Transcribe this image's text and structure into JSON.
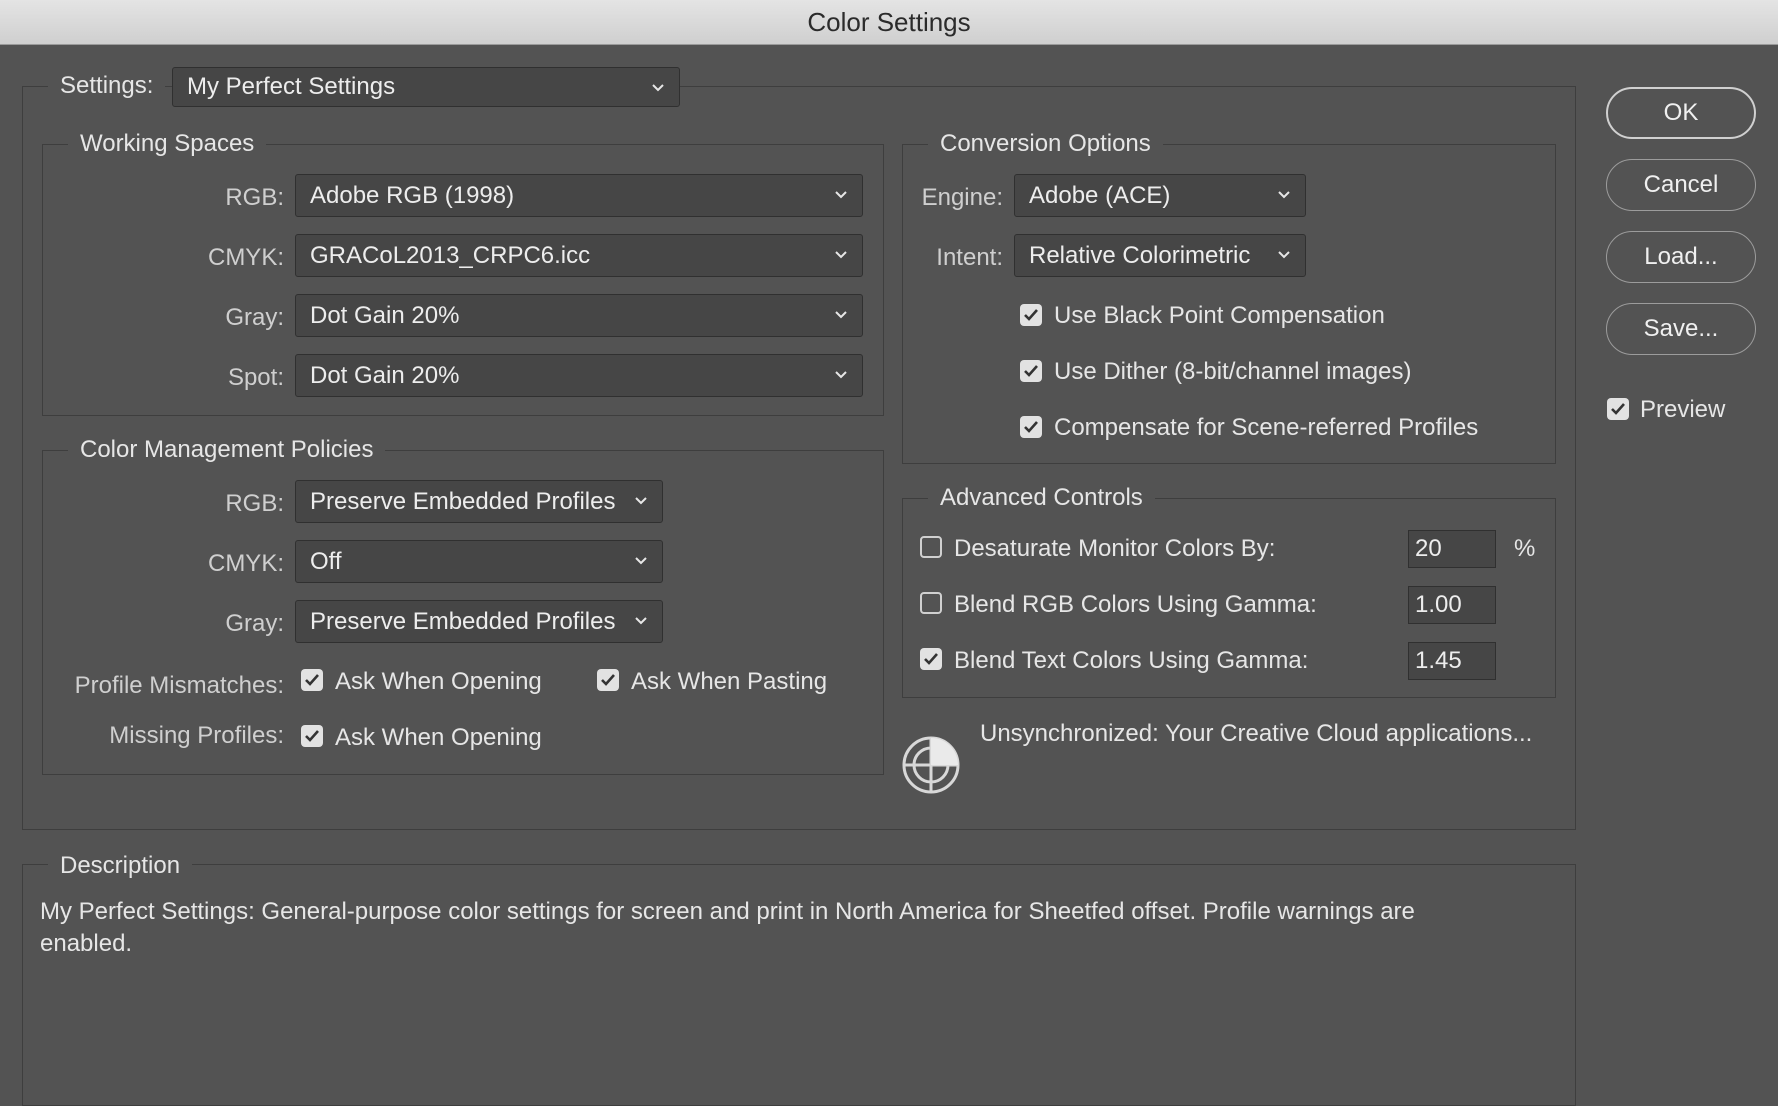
{
  "window": {
    "title": "Color Settings"
  },
  "settings": {
    "label": "Settings:",
    "value": "My Perfect Settings"
  },
  "working_spaces": {
    "title": "Working Spaces",
    "rgb_label": "RGB:",
    "rgb_value": "Adobe RGB (1998)",
    "cmyk_label": "CMYK:",
    "cmyk_value": "GRACoL2013_CRPC6.icc",
    "gray_label": "Gray:",
    "gray_value": "Dot Gain 20%",
    "spot_label": "Spot:",
    "spot_value": "Dot Gain 20%"
  },
  "policies": {
    "title": "Color Management Policies",
    "rgb_label": "RGB:",
    "rgb_value": "Preserve Embedded Profiles",
    "cmyk_label": "CMYK:",
    "cmyk_value": "Off",
    "gray_label": "Gray:",
    "gray_value": "Preserve Embedded Profiles",
    "mismatch_label": "Profile Mismatches:",
    "mismatch_opening": "Ask When Opening",
    "mismatch_pasting": "Ask When Pasting",
    "missing_label": "Missing Profiles:",
    "missing_opening": "Ask When Opening"
  },
  "conversion": {
    "title": "Conversion Options",
    "engine_label": "Engine:",
    "engine_value": "Adobe (ACE)",
    "intent_label": "Intent:",
    "intent_value": "Relative Colorimetric",
    "black_point": "Use Black Point Compensation",
    "dither": "Use Dither (8-bit/channel images)",
    "scene_referred": "Compensate for Scene-referred Profiles"
  },
  "advanced": {
    "title": "Advanced Controls",
    "desaturate_label": "Desaturate Monitor Colors By:",
    "desaturate_value": "20",
    "desaturate_unit": "%",
    "blend_rgb_label": "Blend RGB Colors Using Gamma:",
    "blend_rgb_value": "1.00",
    "blend_text_label": "Blend Text Colors Using Gamma:",
    "blend_text_value": "1.45"
  },
  "sync": {
    "text": "Unsynchronized: Your Creative Cloud applications..."
  },
  "buttons": {
    "ok": "OK",
    "cancel": "Cancel",
    "load": "Load...",
    "save": "Save...",
    "preview": "Preview"
  },
  "description": {
    "title": "Description",
    "text": "My Perfect Settings:  General-purpose color settings for screen and print in North America for Sheetfed offset. Profile warnings are enabled."
  },
  "icons": {
    "chevron": "chevron-down-icon",
    "check": "checkmark-icon",
    "sync": "color-sync-icon"
  }
}
